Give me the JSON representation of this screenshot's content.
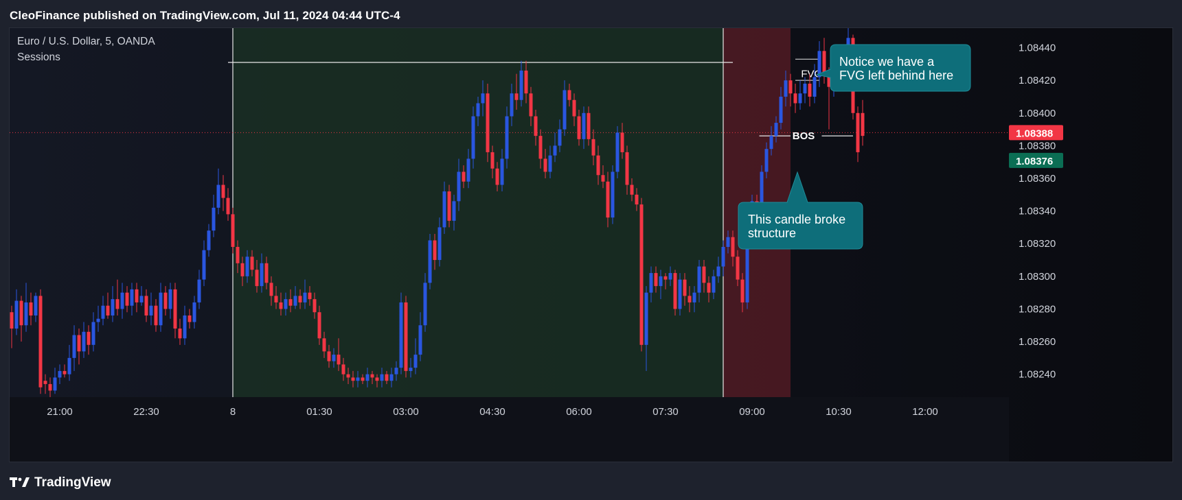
{
  "header": {
    "publisher_line": "CleoFinance published on TradingView.com, Jul 11, 2024 04:44 UTC-4"
  },
  "footer": {
    "brand": "TradingView"
  },
  "colors": {
    "up": "#2a56e0",
    "down": "#f23645",
    "session_green": "#1b3324",
    "session_red": "#5a1c26",
    "callout": "#0e6e7a",
    "price_now": "#f23645",
    "price_alt": "#0b6e54"
  },
  "chart_data": {
    "type": "candlestick",
    "symbol_line": "Euro / U.S. Dollar, 5, OANDA",
    "indicator_line": "Sessions",
    "x_ticks": [
      {
        "label": "21:00",
        "idx": 10
      },
      {
        "label": "22:30",
        "idx": 28
      },
      {
        "label": "8",
        "idx": 46
      },
      {
        "label": "01:30",
        "idx": 64
      },
      {
        "label": "03:00",
        "idx": 82
      },
      {
        "label": "04:30",
        "idx": 100
      },
      {
        "label": "06:00",
        "idx": 118
      },
      {
        "label": "07:30",
        "idx": 136
      },
      {
        "label": "09:00",
        "idx": 154
      },
      {
        "label": "10:30",
        "idx": 172
      },
      {
        "label": "12:00",
        "idx": 190
      }
    ],
    "y_ticks": [
      "1.08440",
      "1.08420",
      "1.08400",
      "1.08380",
      "1.08360",
      "1.08340",
      "1.08320",
      "1.08300",
      "1.08280",
      "1.08260",
      "1.08240"
    ],
    "ylim": [
      1.08226,
      1.08452
    ],
    "price_labels": [
      {
        "value": "1.08388",
        "price": 1.08388,
        "style": "now"
      },
      {
        "value": "1.08376",
        "price": 1.08376,
        "style": "alt"
      }
    ],
    "sessions": [
      {
        "from_idx": 46,
        "to_idx": 148,
        "color": "green"
      },
      {
        "from_idx": 148,
        "to_idx": 162,
        "color": "red"
      }
    ],
    "annotations": {
      "fvg_label": "FVG",
      "bos_label": "BOS",
      "callout_top": [
        "Notice we have a",
        "FVG left behind here"
      ],
      "callout_bottom": [
        "This candle broke",
        "structure"
      ]
    },
    "candles": [
      [
        1.08278,
        1.08268,
        1.08282,
        1.08256
      ],
      [
        1.08268,
        1.08285,
        1.08292,
        1.08264
      ],
      [
        1.08285,
        1.0827,
        1.08288,
        1.0826
      ],
      [
        1.0827,
        1.08284,
        1.08296,
        1.08266
      ],
      [
        1.08284,
        1.08276,
        1.0829,
        1.0827
      ],
      [
        1.08276,
        1.08288,
        1.0829,
        1.08272
      ],
      [
        1.08288,
        1.08232,
        1.08292,
        1.08228
      ],
      [
        1.08236,
        1.08234,
        1.0824,
        1.08228
      ],
      [
        1.08234,
        1.0823,
        1.08238,
        1.08226
      ],
      [
        1.0823,
        1.08238,
        1.08244,
        1.08228
      ],
      [
        1.08238,
        1.08242,
        1.08246,
        1.08234
      ],
      [
        1.08242,
        1.0824,
        1.08246,
        1.08238
      ],
      [
        1.0824,
        1.0825,
        1.08258,
        1.08236
      ],
      [
        1.0825,
        1.08264,
        1.0827,
        1.08242
      ],
      [
        1.08264,
        1.08254,
        1.08268,
        1.08246
      ],
      [
        1.08254,
        1.08266,
        1.08272,
        1.0825
      ],
      [
        1.08266,
        1.08258,
        1.0827,
        1.08252
      ],
      [
        1.08258,
        1.08272,
        1.08278,
        1.08254
      ],
      [
        1.08272,
        1.08274,
        1.08282,
        1.08266
      ],
      [
        1.08274,
        1.08282,
        1.08288,
        1.0827
      ],
      [
        1.08282,
        1.08276,
        1.0829,
        1.08274
      ],
      [
        1.08276,
        1.08286,
        1.08294,
        1.08272
      ],
      [
        1.08286,
        1.0828,
        1.08298,
        1.08276
      ],
      [
        1.0828,
        1.0829,
        1.08296,
        1.08274
      ],
      [
        1.0829,
        1.08282,
        1.08294,
        1.08278
      ],
      [
        1.08282,
        1.08292,
        1.08296,
        1.08276
      ],
      [
        1.08292,
        1.08284,
        1.08296,
        1.08278
      ],
      [
        1.08284,
        1.08288,
        1.08294,
        1.08282
      ],
      [
        1.08288,
        1.08276,
        1.08292,
        1.08272
      ],
      [
        1.08276,
        1.08282,
        1.0829,
        1.0827
      ],
      [
        1.08282,
        1.0827,
        1.08286,
        1.08266
      ],
      [
        1.0827,
        1.0829,
        1.08296,
        1.08266
      ],
      [
        1.0829,
        1.0828,
        1.08294,
        1.08276
      ],
      [
        1.0828,
        1.08292,
        1.08296,
        1.08274
      ],
      [
        1.08292,
        1.08268,
        1.08296,
        1.08262
      ],
      [
        1.08268,
        1.08262,
        1.08274,
        1.08258
      ],
      [
        1.08262,
        1.08276,
        1.08282,
        1.08258
      ],
      [
        1.08276,
        1.08272,
        1.0828,
        1.08268
      ],
      [
        1.08272,
        1.08284,
        1.08288,
        1.08268
      ],
      [
        1.08284,
        1.08298,
        1.08304,
        1.0828
      ],
      [
        1.08298,
        1.08316,
        1.08322,
        1.08294
      ],
      [
        1.08316,
        1.08328,
        1.08332,
        1.08312
      ],
      [
        1.08328,
        1.08342,
        1.0835,
        1.08324
      ],
      [
        1.08342,
        1.08356,
        1.08366,
        1.08338
      ],
      [
        1.08356,
        1.08348,
        1.08362,
        1.0834
      ],
      [
        1.08348,
        1.08338,
        1.08354,
        1.08334
      ],
      [
        1.08338,
        1.08318,
        1.08342,
        1.08314
      ],
      [
        1.08318,
        1.08308,
        1.08322,
        1.08302
      ],
      [
        1.08308,
        1.083,
        1.08312,
        1.08294
      ],
      [
        1.083,
        1.08312,
        1.08316,
        1.08296
      ],
      [
        1.08312,
        1.08304,
        1.08316,
        1.083
      ],
      [
        1.08304,
        1.08294,
        1.0831,
        1.0829
      ],
      [
        1.08294,
        1.08308,
        1.08314,
        1.0829
      ],
      [
        1.08308,
        1.08296,
        1.08312,
        1.08292
      ],
      [
        1.08296,
        1.08288,
        1.083,
        1.08282
      ],
      [
        1.08288,
        1.08284,
        1.08294,
        1.0828
      ],
      [
        1.08284,
        1.0828,
        1.0829,
        1.08276
      ],
      [
        1.0828,
        1.08286,
        1.0829,
        1.08276
      ],
      [
        1.08286,
        1.08282,
        1.08292,
        1.08278
      ],
      [
        1.08282,
        1.08288,
        1.08294,
        1.0828
      ],
      [
        1.08288,
        1.08284,
        1.08292,
        1.0828
      ],
      [
        1.08284,
        1.0829,
        1.08298,
        1.0828
      ],
      [
        1.0829,
        1.08286,
        1.08294,
        1.08282
      ],
      [
        1.08286,
        1.08278,
        1.0829,
        1.08274
      ],
      [
        1.08278,
        1.08262,
        1.08282,
        1.08258
      ],
      [
        1.08262,
        1.08254,
        1.08266,
        1.0825
      ],
      [
        1.08254,
        1.08248,
        1.08258,
        1.08244
      ],
      [
        1.08248,
        1.08252,
        1.08256,
        1.08244
      ],
      [
        1.08252,
        1.08246,
        1.08262,
        1.08242
      ],
      [
        1.08246,
        1.0824,
        1.0825,
        1.08236
      ],
      [
        1.0824,
        1.08238,
        1.08244,
        1.08234
      ],
      [
        1.08238,
        1.08236,
        1.08242,
        1.08232
      ],
      [
        1.08236,
        1.08238,
        1.08242,
        1.08232
      ],
      [
        1.08238,
        1.08236,
        1.0824,
        1.08234
      ],
      [
        1.08236,
        1.0824,
        1.08244,
        1.08232
      ],
      [
        1.0824,
        1.08238,
        1.08242,
        1.08234
      ],
      [
        1.08238,
        1.08236,
        1.0824,
        1.08232
      ],
      [
        1.08236,
        1.0824,
        1.08244,
        1.08232
      ],
      [
        1.0824,
        1.08236,
        1.08242,
        1.08234
      ],
      [
        1.08236,
        1.0824,
        1.08244,
        1.08232
      ],
      [
        1.0824,
        1.08244,
        1.08248,
        1.08236
      ],
      [
        1.08244,
        1.08284,
        1.0829,
        1.0824
      ],
      [
        1.08284,
        1.08242,
        1.08288,
        1.08238
      ],
      [
        1.08242,
        1.08244,
        1.0825,
        1.08238
      ],
      [
        1.08244,
        1.08252,
        1.08262,
        1.0824
      ],
      [
        1.08252,
        1.0827,
        1.08278,
        1.08248
      ],
      [
        1.0827,
        1.08296,
        1.08302,
        1.08266
      ],
      [
        1.08296,
        1.08322,
        1.08326,
        1.08292
      ],
      [
        1.08322,
        1.0831,
        1.08326,
        1.08304
      ],
      [
        1.0831,
        1.0833,
        1.08336,
        1.08306
      ],
      [
        1.0833,
        1.08352,
        1.08358,
        1.08326
      ],
      [
        1.08352,
        1.08334,
        1.08356,
        1.0833
      ],
      [
        1.08334,
        1.08346,
        1.0835,
        1.08328
      ],
      [
        1.08346,
        1.08364,
        1.08372,
        1.0834
      ],
      [
        1.08364,
        1.08358,
        1.08368,
        1.08354
      ],
      [
        1.08358,
        1.08372,
        1.08378,
        1.08354
      ],
      [
        1.08372,
        1.08398,
        1.08404,
        1.08366
      ],
      [
        1.08398,
        1.08406,
        1.0841,
        1.08392
      ],
      [
        1.08406,
        1.08412,
        1.0842,
        1.08398
      ],
      [
        1.08412,
        1.08376,
        1.08418,
        1.0837
      ],
      [
        1.08376,
        1.08366,
        1.0838,
        1.0836
      ],
      [
        1.08366,
        1.08356,
        1.0837,
        1.08352
      ],
      [
        1.08356,
        1.08372,
        1.08378,
        1.08352
      ],
      [
        1.08372,
        1.08398,
        1.08404,
        1.08366
      ],
      [
        1.08398,
        1.08412,
        1.08418,
        1.08392
      ],
      [
        1.08412,
        1.08408,
        1.08424,
        1.08402
      ],
      [
        1.08408,
        1.08426,
        1.08432,
        1.08404
      ],
      [
        1.08426,
        1.08412,
        1.08432,
        1.08406
      ],
      [
        1.08412,
        1.08398,
        1.08416,
        1.08392
      ],
      [
        1.08398,
        1.08386,
        1.08402,
        1.0838
      ],
      [
        1.08386,
        1.08372,
        1.0839,
        1.08366
      ],
      [
        1.08372,
        1.08364,
        1.08378,
        1.0836
      ],
      [
        1.08364,
        1.08374,
        1.0838,
        1.0836
      ],
      [
        1.08374,
        1.0838,
        1.08388,
        1.0837
      ],
      [
        1.0838,
        1.0839,
        1.08396,
        1.08376
      ],
      [
        1.0839,
        1.08414,
        1.0842,
        1.08386
      ],
      [
        1.08414,
        1.08408,
        1.08418,
        1.08404
      ],
      [
        1.08408,
        1.08398,
        1.08412,
        1.08392
      ],
      [
        1.08398,
        1.08384,
        1.08402,
        1.0838
      ],
      [
        1.08384,
        1.084,
        1.08404,
        1.08378
      ],
      [
        1.084,
        1.08384,
        1.08404,
        1.0838
      ],
      [
        1.08384,
        1.08374,
        1.0839,
        1.08368
      ],
      [
        1.08374,
        1.08362,
        1.0838,
        1.08356
      ],
      [
        1.08362,
        1.08358,
        1.08368,
        1.08354
      ],
      [
        1.08358,
        1.08336,
        1.08364,
        1.0833
      ],
      [
        1.08336,
        1.08364,
        1.08368,
        1.08332
      ],
      [
        1.08364,
        1.08388,
        1.08392,
        1.0836
      ],
      [
        1.08388,
        1.08376,
        1.08394,
        1.08372
      ],
      [
        1.08376,
        1.08356,
        1.0838,
        1.0835
      ],
      [
        1.08356,
        1.0835,
        1.0836,
        1.08346
      ],
      [
        1.0835,
        1.08344,
        1.08354,
        1.0834
      ],
      [
        1.08344,
        1.08258,
        1.08348,
        1.08254
      ],
      [
        1.08258,
        1.0829,
        1.08294,
        1.08242
      ],
      [
        1.0829,
        1.08302,
        1.08306,
        1.08284
      ],
      [
        1.08302,
        1.08294,
        1.08306,
        1.0829
      ],
      [
        1.08294,
        1.083,
        1.08304,
        1.08286
      ],
      [
        1.083,
        1.08298,
        1.08302,
        1.08292
      ],
      [
        1.08298,
        1.08302,
        1.08306,
        1.08294
      ],
      [
        1.08302,
        1.0828,
        1.08304,
        1.08276
      ],
      [
        1.0828,
        1.08298,
        1.08302,
        1.08276
      ],
      [
        1.08298,
        1.08288,
        1.08302,
        1.08282
      ],
      [
        1.08288,
        1.08284,
        1.08294,
        1.08278
      ],
      [
        1.08284,
        1.0829,
        1.08294,
        1.08278
      ],
      [
        1.0829,
        1.08306,
        1.0831,
        1.08284
      ],
      [
        1.08306,
        1.08296,
        1.0831,
        1.0829
      ],
      [
        1.08296,
        1.0829,
        1.083,
        1.08284
      ],
      [
        1.0829,
        1.083,
        1.08304,
        1.08286
      ],
      [
        1.083,
        1.08306,
        1.08312,
        1.08296
      ],
      [
        1.08306,
        1.08318,
        1.08322,
        1.083
      ],
      [
        1.08318,
        1.08324,
        1.08328,
        1.08314
      ],
      [
        1.08324,
        1.08312,
        1.08328,
        1.08306
      ],
      [
        1.08312,
        1.08298,
        1.08316,
        1.08294
      ],
      [
        1.08298,
        1.08284,
        1.08302,
        1.08278
      ],
      [
        1.08284,
        1.08336,
        1.0834,
        1.0828
      ],
      [
        1.08336,
        1.08346,
        1.0835,
        1.0833
      ],
      [
        1.08346,
        1.08338,
        1.0835,
        1.08332
      ],
      [
        1.08338,
        1.08364,
        1.08368,
        1.08334
      ],
      [
        1.08364,
        1.08378,
        1.08382,
        1.0836
      ],
      [
        1.08378,
        1.08386,
        1.08392,
        1.08374
      ],
      [
        1.08386,
        1.08394,
        1.08398,
        1.08382
      ],
      [
        1.08394,
        1.0841,
        1.08416,
        1.0839
      ],
      [
        1.0841,
        1.0842,
        1.08426,
        1.08404
      ],
      [
        1.0842,
        1.08412,
        1.08424,
        1.08404
      ],
      [
        1.08412,
        1.08406,
        1.08418,
        1.084
      ],
      [
        1.08406,
        1.08412,
        1.0842,
        1.08402
      ],
      [
        1.08412,
        1.08418,
        1.08422,
        1.08406
      ],
      [
        1.08418,
        1.0841,
        1.08424,
        1.08404
      ],
      [
        1.0841,
        1.08422,
        1.0843,
        1.08406
      ],
      [
        1.08422,
        1.08438,
        1.08444,
        1.08416
      ],
      [
        1.08438,
        1.08424,
        1.08446,
        1.08418
      ],
      [
        1.08424,
        1.08416,
        1.08428,
        1.0839
      ],
      [
        1.08416,
        1.08432,
        1.08436,
        1.0841
      ],
      [
        1.08432,
        1.08426,
        1.08438,
        1.0842
      ],
      [
        1.08426,
        1.08434,
        1.0844,
        1.08422
      ],
      [
        1.08434,
        1.08446,
        1.08452,
        1.0843
      ],
      [
        1.08446,
        1.084,
        1.08448,
        1.08396
      ],
      [
        1.084,
        1.08376,
        1.08404,
        1.0837
      ],
      [
        1.084,
        1.08386,
        1.08408,
        1.0838
      ]
    ]
  }
}
